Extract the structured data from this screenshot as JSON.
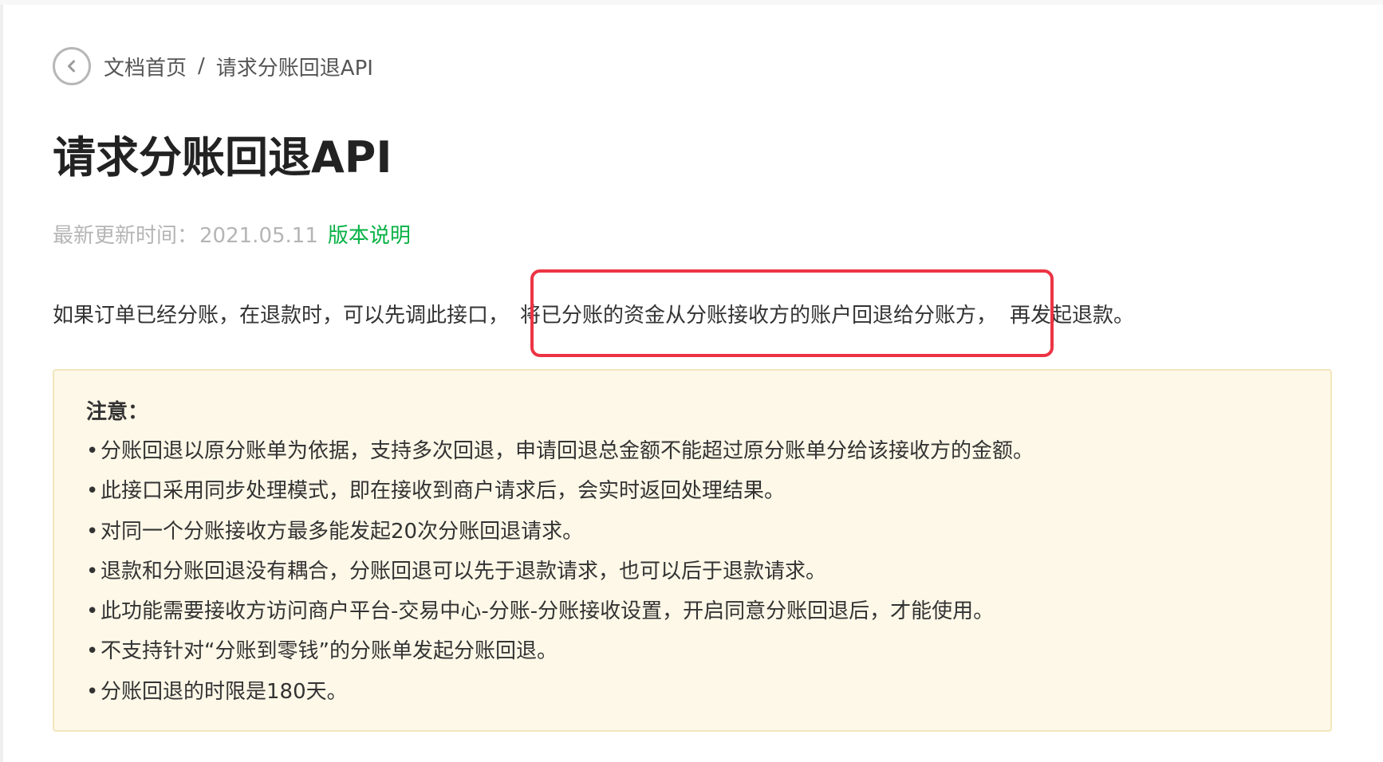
{
  "breadcrumb": {
    "back_icon": "chevron-left-icon",
    "home": "文档首页",
    "separator": "/",
    "current": "请求分账回退API"
  },
  "page": {
    "title": "请求分账回退API",
    "meta_label": "最新更新时间：",
    "meta_date": "2021.05.11",
    "version_link": "版本说明"
  },
  "intro": {
    "before": "如果订单已经分账，在退款时，可以先调此接口，",
    "highlight": "将已分账的资金从分账接收方的账户回退给分账方，",
    "after": "再发起退款。"
  },
  "notice": {
    "title": "注意：",
    "bullet": "•",
    "items": [
      "分账回退以原分账单为依据，支持多次回退，申请回退总金额不能超过原分账单分给该接收方的金额。",
      "此接口采用同步处理模式，即在接收到商户请求后，会实时返回处理结果。",
      "对同一个分账接收方最多能发起20次分账回退请求。",
      "退款和分账回退没有耦合，分账回退可以先于退款请求，也可以后于退款请求。",
      "此功能需要接收方访问商户平台-交易中心-分账-分账接收设置，开启同意分账回退后，才能使用。",
      "不支持针对“分账到零钱”的分账单发起分账回退。",
      "分账回退的时限是180天。"
    ]
  },
  "colors": {
    "link_green": "#07b245",
    "highlight_red": "#ec3444",
    "notice_background": "#fdf8e8",
    "notice_border": "#f2e6bc"
  }
}
